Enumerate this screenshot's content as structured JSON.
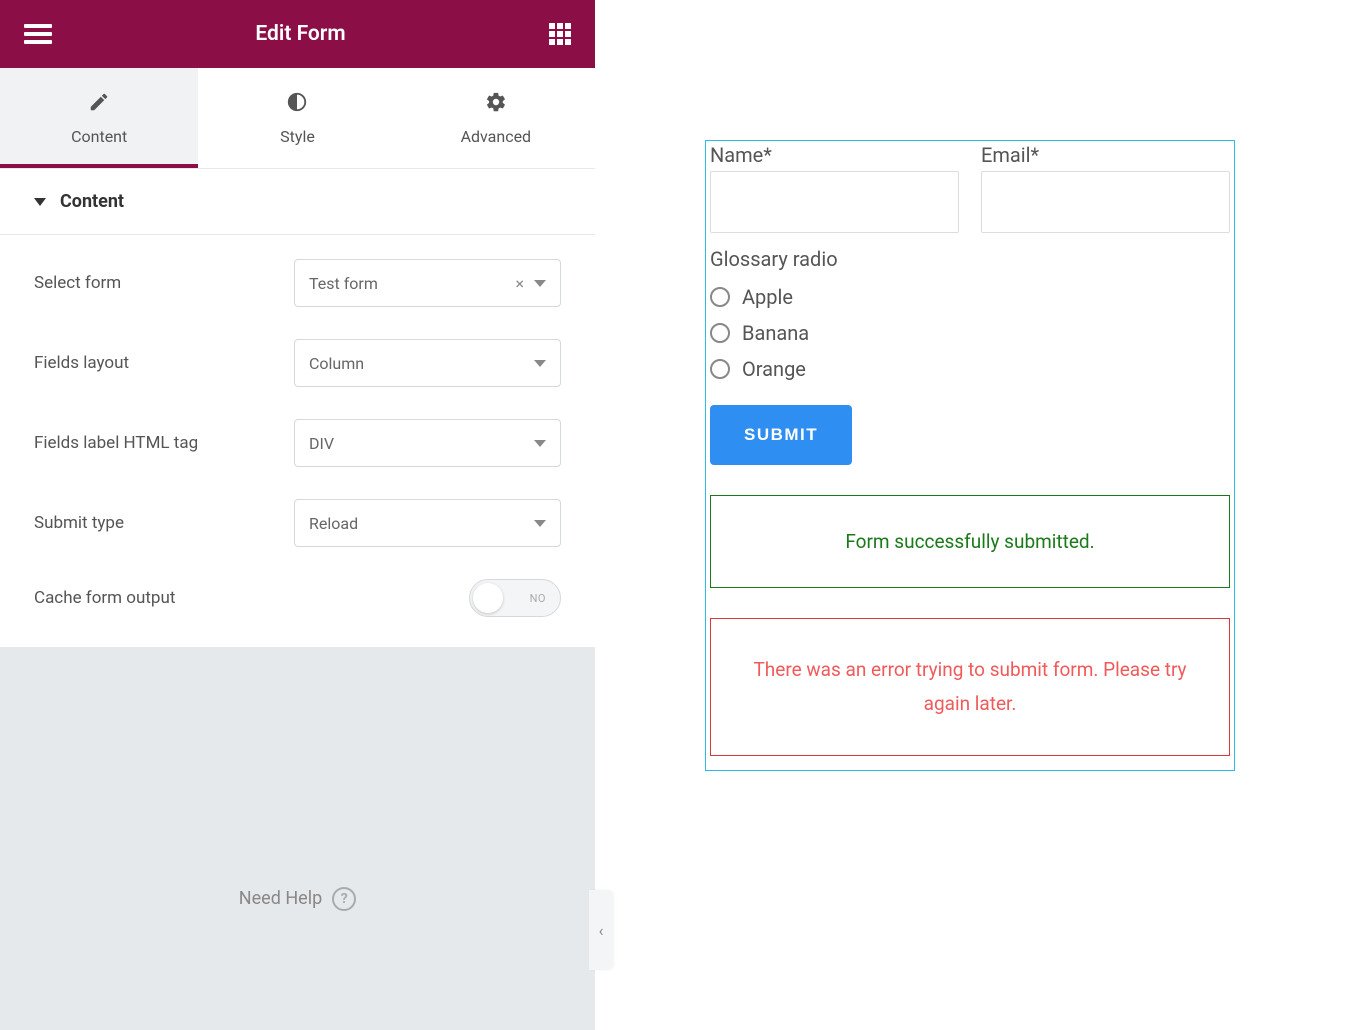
{
  "header": {
    "title": "Edit Form"
  },
  "tabs": {
    "content": "Content",
    "style": "Style",
    "advanced": "Advanced"
  },
  "section": {
    "title": "Content"
  },
  "controls": {
    "select_form": {
      "label": "Select form",
      "value": "Test form"
    },
    "fields_layout": {
      "label": "Fields layout",
      "value": "Column"
    },
    "label_tag": {
      "label": "Fields label HTML tag",
      "value": "DIV"
    },
    "submit_type": {
      "label": "Submit type",
      "value": "Reload"
    },
    "cache": {
      "label": "Cache form output",
      "state": "NO"
    }
  },
  "help": {
    "text": "Need Help"
  },
  "preview": {
    "name_label": "Name*",
    "email_label": "Email*",
    "radio_title": "Glossary radio",
    "radio_options": [
      "Apple",
      "Banana",
      "Orange"
    ],
    "submit": "SUBMIT",
    "success": "Form successfully submitted.",
    "error": "There was an error trying to submit form. Please try again later."
  }
}
